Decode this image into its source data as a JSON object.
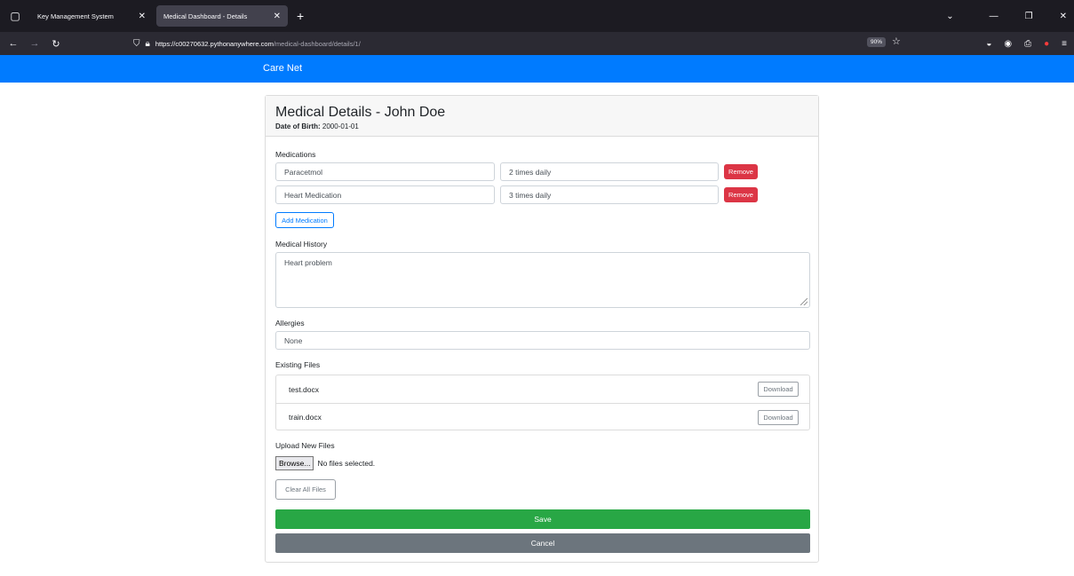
{
  "browser": {
    "tabs": [
      {
        "title": "Key Management System"
      },
      {
        "title": "Medical Dashboard - Details"
      }
    ],
    "url_host": "https://c00270632.pythonanywhere.com",
    "url_path": "/medical-dashboard/details/1/",
    "zoom": "90%"
  },
  "app": {
    "brand": "Care Net"
  },
  "header": {
    "title": "Medical Details - John Doe",
    "dob_label": "Date of Birth:",
    "dob_value": "2000-01-01"
  },
  "medications": {
    "label": "Medications",
    "items": [
      {
        "name": "Paracetmol",
        "frequency": "2 times daily",
        "remove": "Remove"
      },
      {
        "name": "Heart Medication",
        "frequency": "3 times daily",
        "remove": "Remove"
      }
    ],
    "add_label": "Add Medication"
  },
  "history": {
    "label": "Medical History",
    "value": "Heart problem"
  },
  "allergies": {
    "label": "Allergies",
    "value": "None"
  },
  "files": {
    "label": "Existing Files",
    "items": [
      {
        "name": "test.docx",
        "download": "Download"
      },
      {
        "name": "train.docx",
        "download": "Download"
      }
    ]
  },
  "upload": {
    "label": "Upload New Files",
    "browse": "Browse...",
    "status": "No files selected.",
    "clear": "Clear All Files"
  },
  "actions": {
    "save": "Save",
    "cancel": "Cancel"
  }
}
